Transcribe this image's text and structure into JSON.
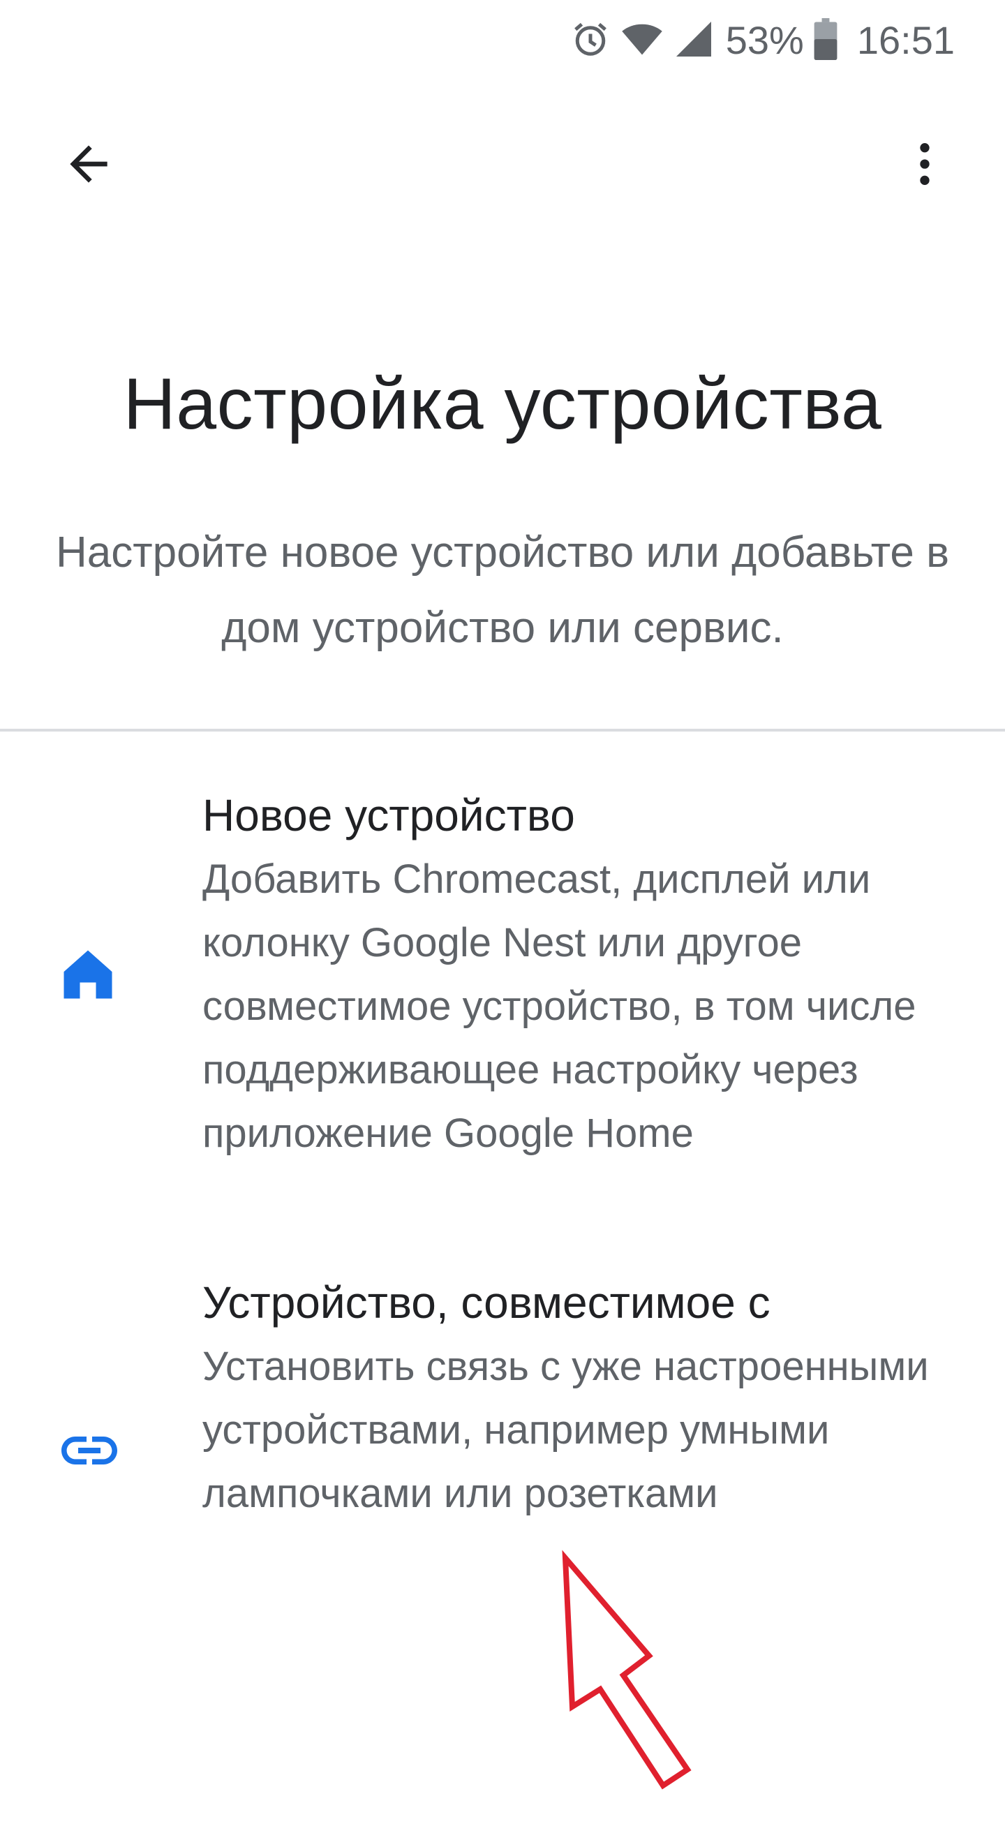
{
  "status_bar": {
    "icons": [
      "alarm-icon",
      "wifi-icon",
      "cell-signal-icon",
      "battery-icon"
    ],
    "battery_percent": "53%",
    "time": "16:51"
  },
  "toolbar": {
    "back_icon": "arrow-back-icon",
    "more_icon": "more-vert-icon"
  },
  "header": {
    "title": "Настройка устройства",
    "subtitle": "Настройте новое устройство или добавьте в дом устройство или сервис."
  },
  "options": [
    {
      "icon": "home-icon",
      "title": "Новое устройство",
      "description": "Добавить Chromecast, дисплей или колонку Google Nest или другое совместимое устройство, в том числе поддерживающее настройку через приложение Google Home"
    },
    {
      "icon": "link-icon",
      "title": "Устройство, совместимое с",
      "description": "Установить связь с уже настроенными устройствами, например умными лампочками или розетками"
    }
  ],
  "colors": {
    "accent": "#1a73e8",
    "text_primary": "#202124",
    "text_secondary": "#5f6368",
    "annotation": "#e0202e"
  }
}
